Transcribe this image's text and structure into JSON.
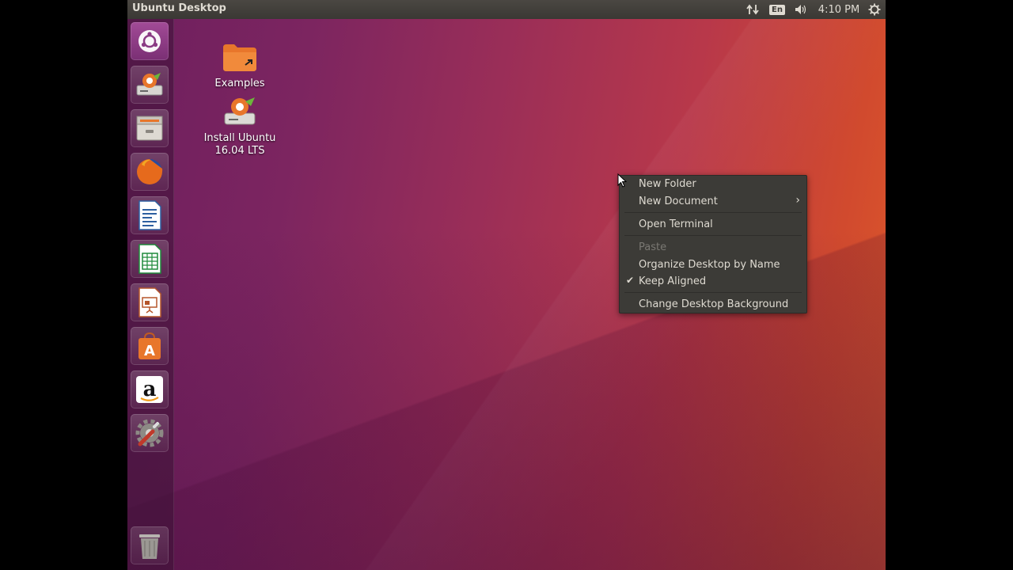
{
  "topbar": {
    "title": "Ubuntu Desktop",
    "keyboard_layout": "En",
    "time": "4:10 PM",
    "icons": [
      "network-transfer-icon",
      "keyboard-layout-icon",
      "volume-icon",
      "clock",
      "settings-gear-icon"
    ]
  },
  "launcher": {
    "items": [
      {
        "name": "dash-home-icon"
      },
      {
        "name": "install-ubuntu-icon"
      },
      {
        "name": "files-icon"
      },
      {
        "name": "firefox-icon"
      },
      {
        "name": "libreoffice-writer-icon"
      },
      {
        "name": "libreoffice-calc-icon"
      },
      {
        "name": "libreoffice-impress-icon"
      },
      {
        "name": "ubuntu-software-icon"
      },
      {
        "name": "amazon-icon"
      },
      {
        "name": "system-settings-icon"
      },
      {
        "name": "trash-icon"
      }
    ]
  },
  "desktop": {
    "icons": [
      {
        "label": "Examples"
      },
      {
        "label": "Install Ubuntu 16.04 LTS"
      }
    ]
  },
  "context_menu": {
    "items": [
      {
        "label": "New Folder"
      },
      {
        "label": "New Document",
        "submenu": true
      },
      {
        "label": "Open Terminal"
      },
      {
        "label": "Paste",
        "disabled": true
      },
      {
        "label": "Organize Desktop by Name"
      },
      {
        "label": "Keep Aligned",
        "checked": true
      },
      {
        "label": "Change Desktop Background"
      }
    ]
  },
  "colors": {
    "menu_bg": "#3c3b37",
    "panel_bg": "#3c3b37",
    "wallpaper_left": "#6e1f5e",
    "wallpaper_right": "#df5a2a"
  }
}
